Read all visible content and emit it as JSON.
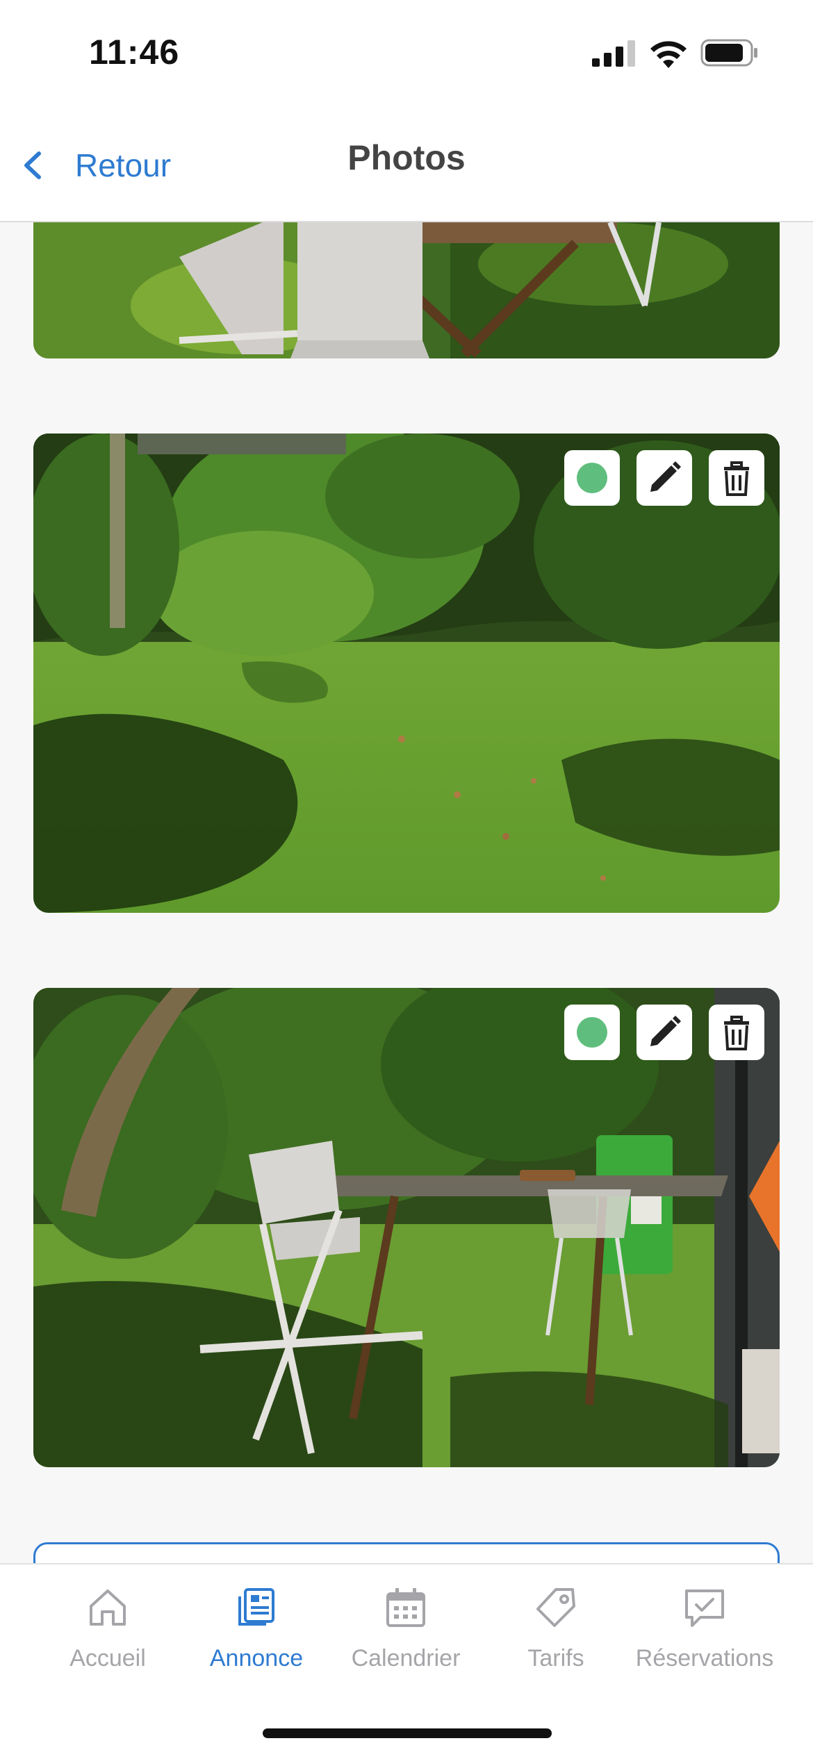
{
  "status_bar": {
    "time": "11:46"
  },
  "nav": {
    "back_label": "Retour",
    "title": "Photos"
  },
  "photos": [
    {
      "id": "terrace-chairs-top",
      "actions": []
    },
    {
      "id": "garden-lawn",
      "actions": [
        "main-indicator",
        "edit-icon",
        "trash-icon"
      ]
    },
    {
      "id": "garden-table",
      "actions": [
        "main-indicator",
        "edit-icon",
        "trash-icon"
      ]
    }
  ],
  "tabs": [
    {
      "label": "Accueil",
      "icon": "home-icon",
      "active": false
    },
    {
      "label": "Annonce",
      "icon": "listing-icon",
      "active": true
    },
    {
      "label": "Calendrier",
      "icon": "calendar-icon",
      "active": false
    },
    {
      "label": "Tarifs",
      "icon": "tag-icon",
      "active": false
    },
    {
      "label": "Réservations",
      "icon": "reservations-icon",
      "active": false
    }
  ],
  "colors": {
    "accent": "#2e7bd1",
    "inactive": "#a5a5a9",
    "main_dot": "#5fbe7d",
    "background": "#f7f7f8"
  }
}
